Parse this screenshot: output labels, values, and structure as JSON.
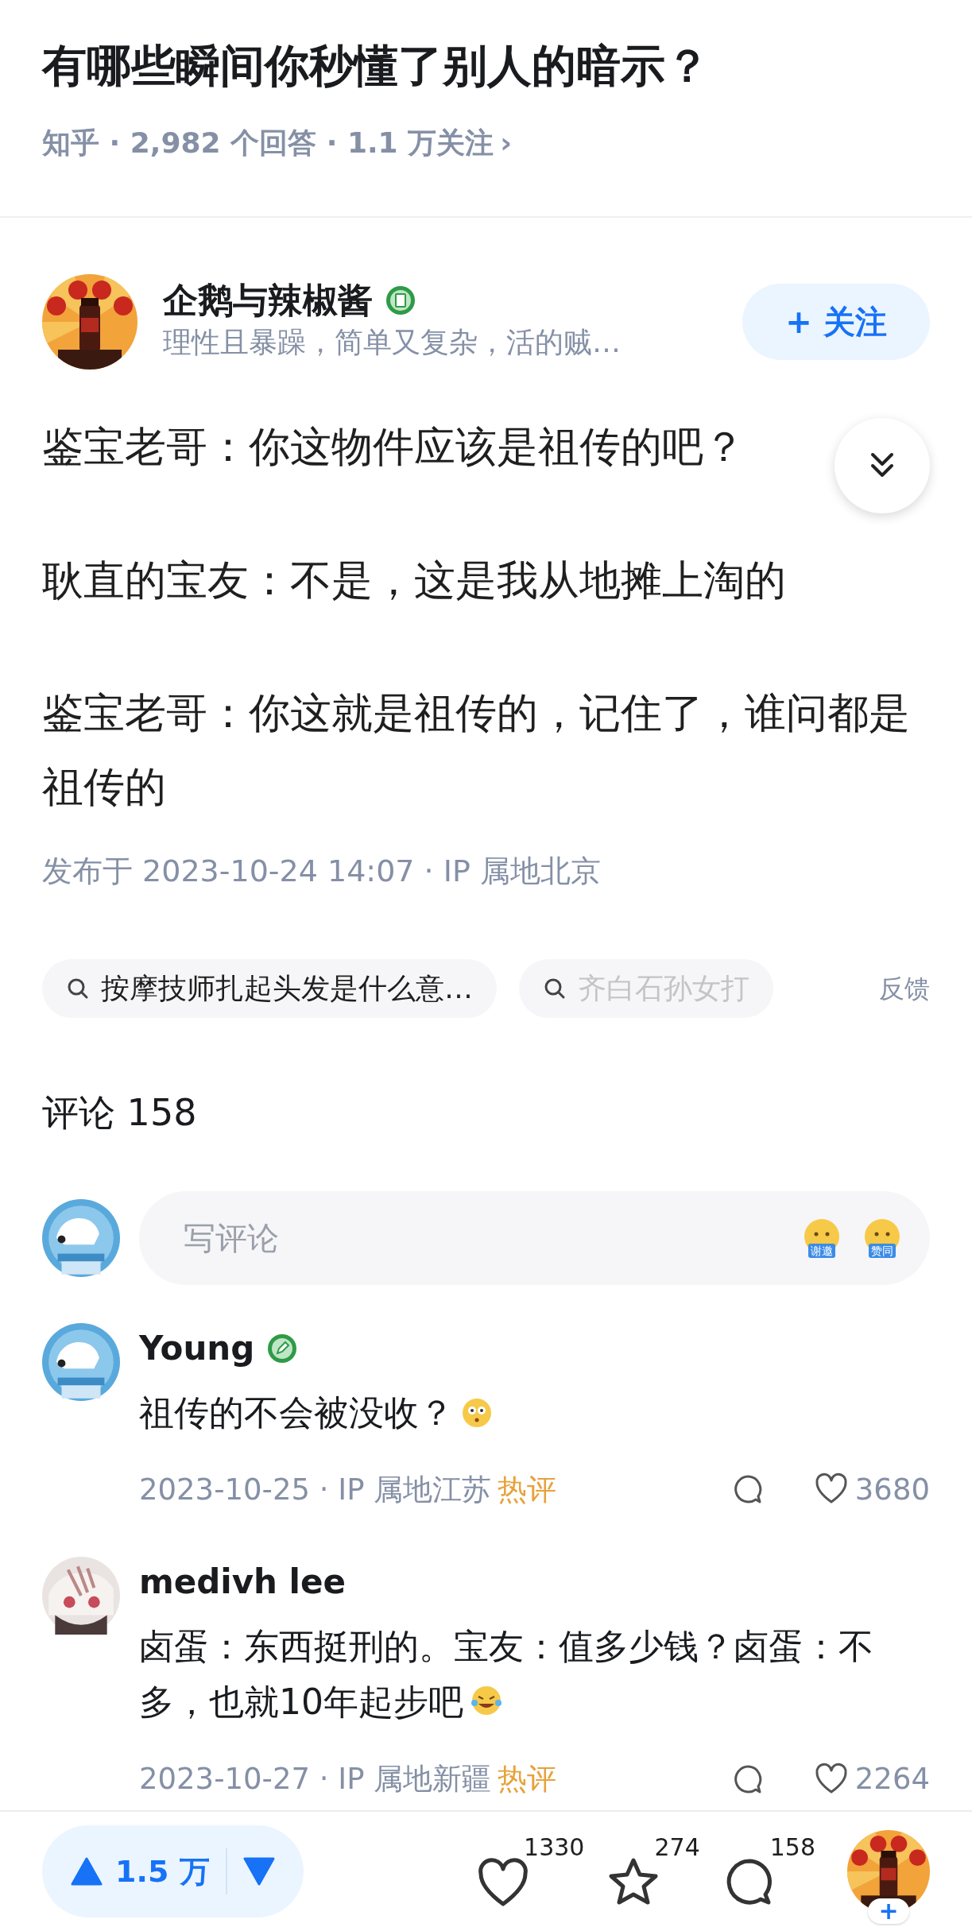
{
  "question": {
    "title": "有哪些瞬间你秒懂了别人的暗示？",
    "meta": "知乎 · 2,982 个回答 · 1.1 万关注",
    "chevron": "›"
  },
  "answer": {
    "author": {
      "name": "企鹅与辣椒酱",
      "verified": true,
      "bio": "理性且暴躁，简单又复杂，活的贼…"
    },
    "follow_button": "+ 关注",
    "paragraphs": [
      "鉴宝老哥：你这物件应该是祖传的吧？",
      "耿直的宝友：不是，这是我从地摊上淘的",
      "鉴宝老哥：你这就是祖传的，记住了，谁问都是祖传的"
    ],
    "published": "发布于 2023-10-24 14:07 · IP 属地北京"
  },
  "related_searches": [
    {
      "text": "按摩技师扎起头发是什么意…",
      "faded": false
    },
    {
      "text": "齐白石孙女打",
      "faded": true
    }
  ],
  "feedback": "反馈",
  "comments_header": "评论 158",
  "comment_input": {
    "placeholder": "写评论",
    "stickers": [
      "谢邀",
      "赞同"
    ]
  },
  "comments": [
    {
      "name": "Young",
      "verified": true,
      "text": "祖传的不会被没收？",
      "date": "2023-10-25 · IP 属地江苏",
      "tag": "热评",
      "likes": "3680"
    },
    {
      "name": "medivh lee",
      "verified": false,
      "text": "卤蛋：东西挺刑的。宝友：值多少钱？卤蛋：不多，也就10年起步吧",
      "date": "2023-10-27 · IP 属地新疆",
      "tag": "热评",
      "likes": "2264"
    }
  ],
  "bottom_bar": {
    "vote": "1.5 万",
    "author_follow": "+",
    "actions": [
      {
        "kind": "like",
        "count": "1330"
      },
      {
        "kind": "star",
        "count": "274"
      },
      {
        "kind": "comment",
        "count": "158"
      }
    ]
  }
}
